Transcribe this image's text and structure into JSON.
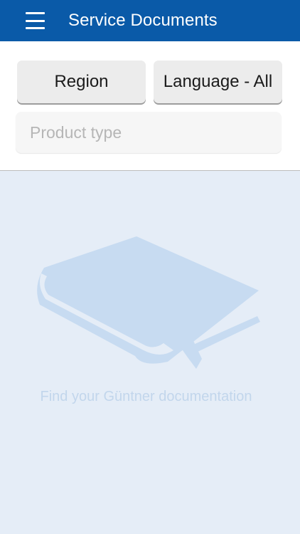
{
  "header": {
    "title": "Service Documents",
    "menu_icon": "hamburger-menu-icon"
  },
  "filters": {
    "region_label": "Region",
    "language_label": "Language - All",
    "product_type_placeholder": "Product type",
    "product_type_value": ""
  },
  "empty_state": {
    "icon": "book-icon",
    "message": "Find your Güntner documentation"
  },
  "colors": {
    "brand": "#0a5aa8",
    "content_background": "#e5edf7",
    "illustration": "#c7dbf1",
    "muted_text": "#c2d6ec"
  }
}
